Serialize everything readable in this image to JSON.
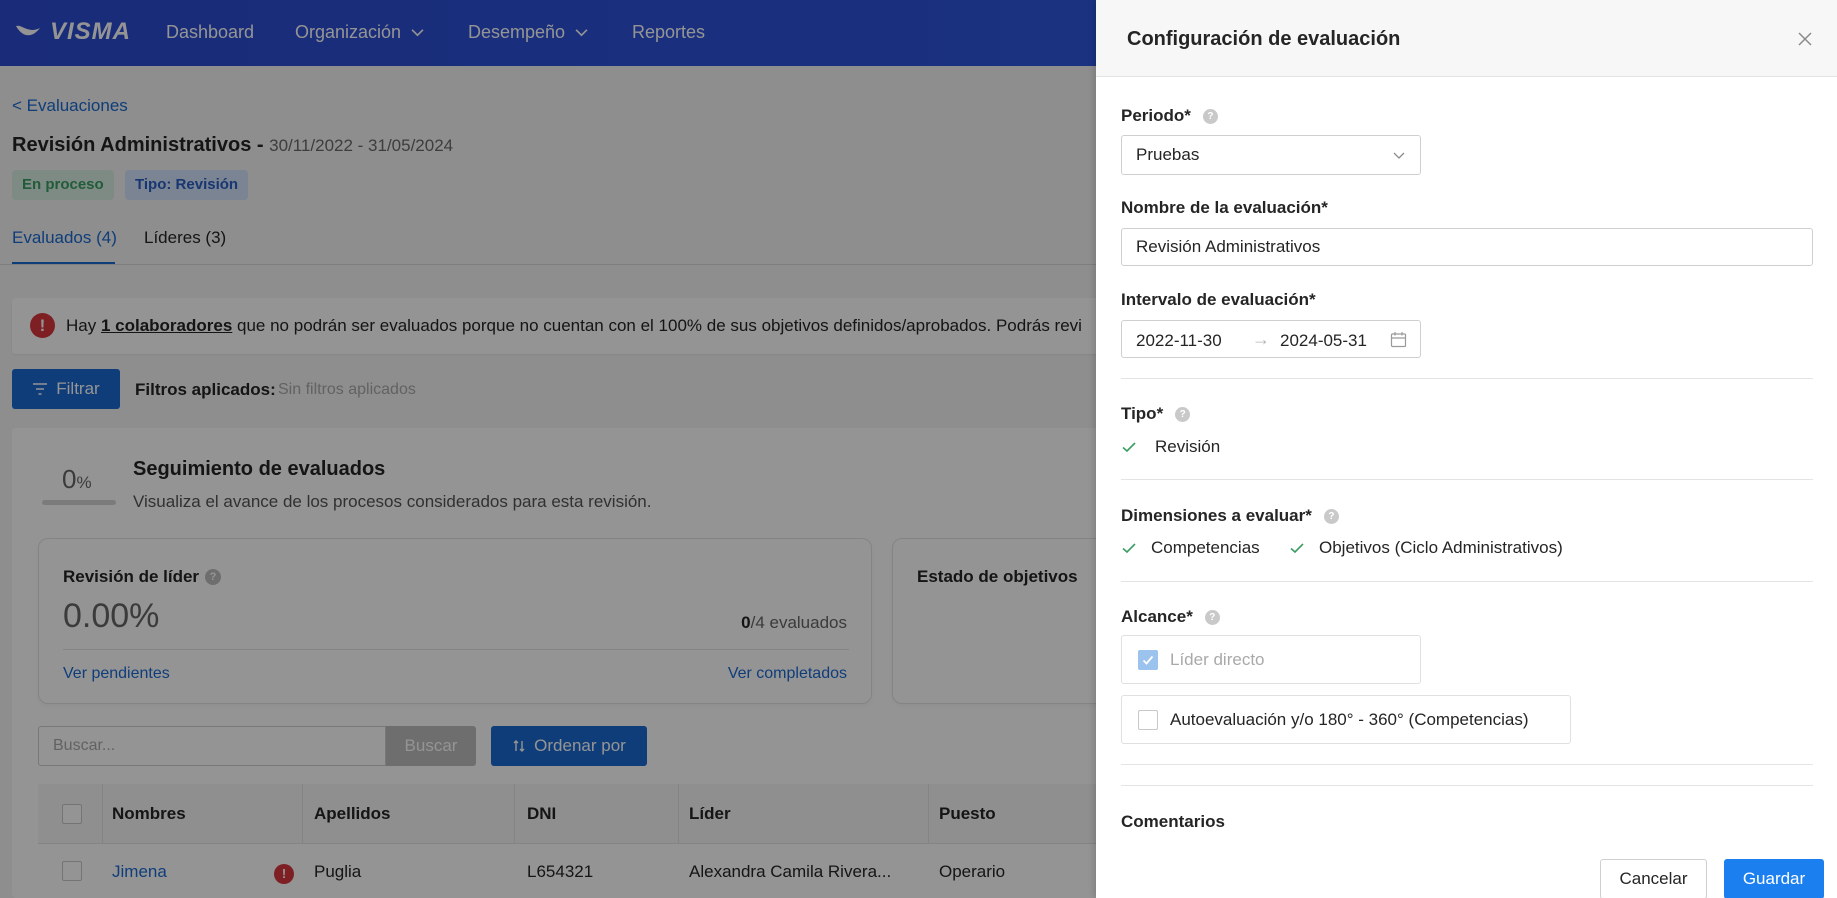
{
  "brand": {
    "logo_text": "VISMA"
  },
  "nav": {
    "items": [
      {
        "label": "Dashboard"
      },
      {
        "label": "Organización"
      },
      {
        "label": "Desempeño"
      },
      {
        "label": "Reportes"
      }
    ]
  },
  "page": {
    "back_link": "< Evaluaciones",
    "title": "Revisión Administrativos -",
    "dates": "30/11/2022 - 31/05/2024",
    "tags": [
      "En proceso",
      "Tipo: Revisión"
    ],
    "tabs": [
      "Evaluados (4)",
      "Líderes (3)"
    ],
    "alert": {
      "before": "Hay ",
      "link": "1 colaboradores",
      "after": " que no podrán ser evaluados porque no cuentan con el 100% de sus objetivos definidos/aprobados. Podrás revi"
    },
    "filter_button": "Filtrar",
    "filters_label": "Filtros aplicados:",
    "filters_value": "Sin filtros aplicados",
    "tracking": {
      "percent": "0",
      "percent_unit": "%",
      "progress_fraction": 0,
      "title": "Seguimiento de evaluados",
      "subtitle": "Visualiza el avance de los procesos considerados para esta revisión."
    },
    "leader_review": {
      "title": "Revisión de líder",
      "value": "0.00%",
      "count_done": "0",
      "count_rest": "/4 evaluados",
      "link_pending": "Ver pendientes",
      "link_done": "Ver completados"
    },
    "objectives_status": {
      "title": "Estado de objetivos"
    },
    "search": {
      "placeholder": "Buscar...",
      "button": "Buscar"
    },
    "sort_button": "Ordenar por",
    "table": {
      "headers": [
        "Nombres",
        "Apellidos",
        "DNI",
        "Líder",
        "Puesto"
      ],
      "rows": [
        {
          "nombres": "Jimena",
          "apellidos": "Puglia",
          "dni": "L654321",
          "lider": "Alexandra Camila Rivera...",
          "puesto": "Operario"
        }
      ]
    }
  },
  "drawer": {
    "title": "Configuración de evaluación",
    "periodo": {
      "label": "Periodo*",
      "value": "Pruebas"
    },
    "nombre": {
      "label": "Nombre de la evaluación*",
      "value": "Revisión Administrativos"
    },
    "intervalo": {
      "label": "Intervalo de evaluación*",
      "start": "2022-11-30",
      "end": "2024-05-31"
    },
    "tipo": {
      "label": "Tipo*",
      "value": "Revisión"
    },
    "dimensiones": {
      "label": "Dimensiones a evaluar*",
      "items": [
        "Competencias",
        "Objetivos (Ciclo Administrativos)"
      ]
    },
    "alcance": {
      "label": "Alcance*",
      "options": [
        {
          "label": "Líder directo",
          "checked": true,
          "disabled": true
        },
        {
          "label": "Autoevaluación y/o 180° - 360° (Competencias)",
          "checked": false,
          "disabled": false
        }
      ]
    },
    "comentarios": {
      "label": "Comentarios"
    },
    "cancel": "Cancelar",
    "save": "Guardar"
  },
  "colors": {
    "primary": "#1b6ad2",
    "nav": "#2b4bd0",
    "danger": "#d7363d",
    "success": "#3b9e62",
    "save": "#1b7ff0"
  },
  "icons": {
    "nav_chevron": "chevron-down-icon",
    "close": "close-icon",
    "calendar": "calendar-icon",
    "check": "check-icon",
    "help": "help-icon",
    "filter": "filter-icon",
    "sort": "sort-icon",
    "alert": "alert-icon"
  }
}
